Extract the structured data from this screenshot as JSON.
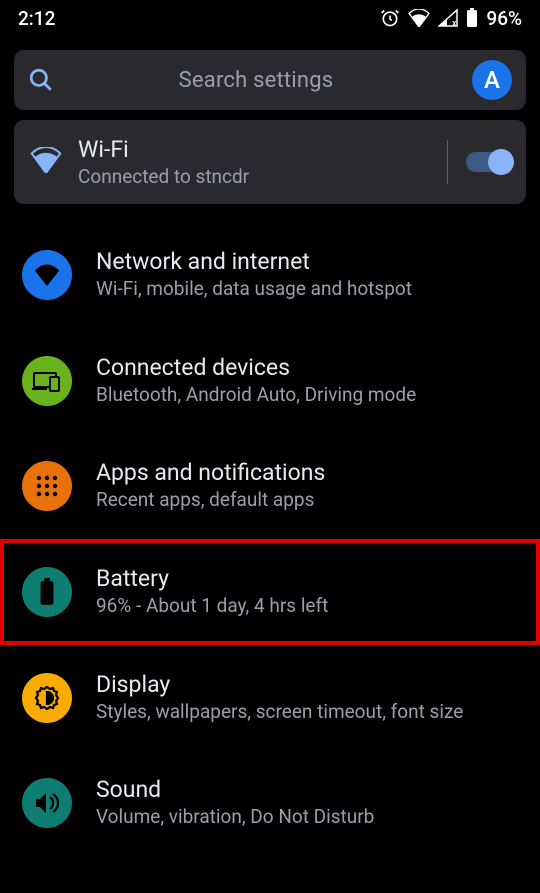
{
  "status": {
    "time": "2:12",
    "battery_pct": "96%"
  },
  "search": {
    "placeholder": "Search settings",
    "avatar_letter": "A"
  },
  "wifi_card": {
    "title": "Wi-Fi",
    "subtitle": "Connected to stncdr",
    "enabled": true
  },
  "rows": [
    {
      "id": "network",
      "title": "Network and internet",
      "subtitle": "Wi-Fi, mobile, data usage and hotspot",
      "icon": "wifi-icon",
      "color": "ic-blue"
    },
    {
      "id": "connected-devices",
      "title": "Connected devices",
      "subtitle": "Bluetooth, Android Auto, Driving mode",
      "icon": "devices-icon",
      "color": "ic-green"
    },
    {
      "id": "apps",
      "title": "Apps and notifications",
      "subtitle": "Recent apps, default apps",
      "icon": "apps-icon",
      "color": "ic-orange"
    },
    {
      "id": "battery",
      "title": "Battery",
      "subtitle": "96% - About 1 day, 4 hrs left",
      "icon": "battery-icon",
      "color": "ic-teal",
      "highlight": true
    },
    {
      "id": "display",
      "title": "Display",
      "subtitle": "Styles, wallpapers, screen timeout, font size",
      "icon": "display-icon",
      "color": "ic-yellow"
    },
    {
      "id": "sound",
      "title": "Sound",
      "subtitle": "Volume, vibration, Do Not Disturb",
      "icon": "sound-icon",
      "color": "ic-teal"
    }
  ]
}
